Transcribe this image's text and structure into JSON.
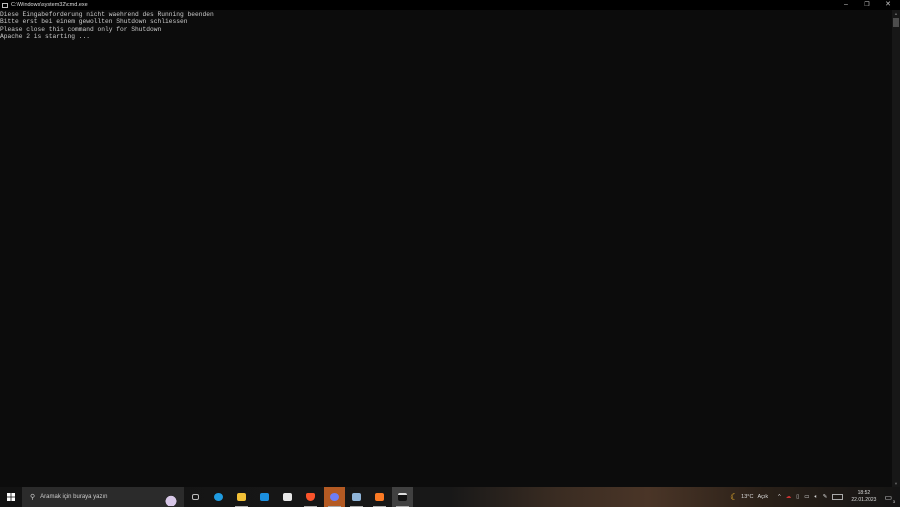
{
  "window": {
    "title": "C:\\Windows\\system32\\cmd.exe",
    "minimize": "–",
    "restore": "❐",
    "close": "✕"
  },
  "console": {
    "lines": [
      "Diese Eingabeforderung nicht waehrend des Running beenden",
      "Bitte erst bei einem gewollten Shutdown schliessen",
      "Please close this command only for Shutdown",
      "Apache 2 is starting ..."
    ]
  },
  "taskbar": {
    "search_placeholder": "Aramak için buraya yazın",
    "apps": [
      {
        "name": "task-view",
        "color": "#bbbbbb"
      },
      {
        "name": "edge",
        "color": "#1f9be0"
      },
      {
        "name": "file-explorer",
        "color": "#f2c037"
      },
      {
        "name": "mail",
        "color": "#1b8fe0"
      },
      {
        "name": "microsoft-store",
        "color": "#e8e8e8"
      },
      {
        "name": "brave",
        "color": "#fb542b"
      },
      {
        "name": "chat-app",
        "color": "#6f7ef5"
      },
      {
        "name": "notepad",
        "color": "#8fb4d8"
      },
      {
        "name": "xampp",
        "color": "#fb7a24"
      },
      {
        "name": "cmd",
        "color": "#222222"
      }
    ],
    "weather": {
      "temp": "13°C",
      "condition": "Açık"
    },
    "time": "18:52",
    "date": "22.01.2023",
    "notifications": "3"
  }
}
